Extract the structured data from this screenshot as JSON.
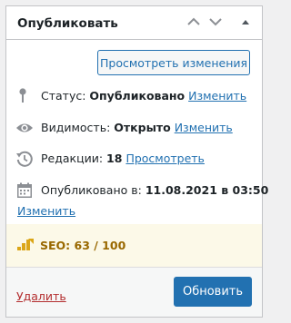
{
  "panel": {
    "title": "Опубликовать"
  },
  "actions": {
    "preview_changes": "Просмотреть изменения"
  },
  "status": {
    "label": "Статус:",
    "value": "Опубликовано",
    "edit": "Изменить",
    "icon": "pin-icon"
  },
  "visibility": {
    "label": "Видимость:",
    "value": "Открыто",
    "edit": "Изменить",
    "icon": "eye-icon"
  },
  "revisions": {
    "label": "Редакции:",
    "value": "18",
    "link": "Просмотреть",
    "icon": "history-icon"
  },
  "published": {
    "label": "Опубликовано в:",
    "value": "11.08.2021 в 03:50",
    "edit": "Изменить",
    "icon": "calendar-icon"
  },
  "seo": {
    "text": "SEO: 63 / 100",
    "color": "#996800",
    "icon": "seo-score-icon"
  },
  "footer": {
    "delete": "Удалить",
    "update": "Обновить"
  },
  "colors": {
    "accent": "#2271b1",
    "danger": "#b32d2e",
    "seo_background": "#fcf9e8"
  }
}
